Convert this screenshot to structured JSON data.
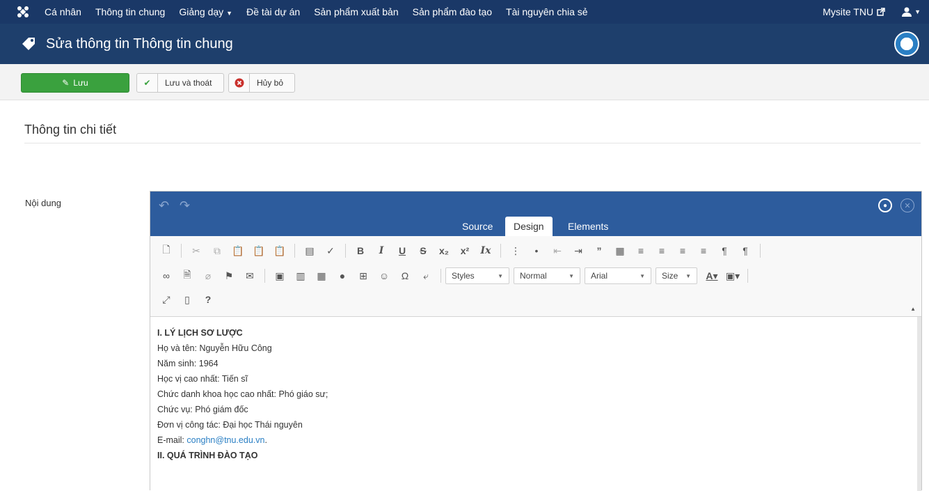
{
  "nav": {
    "items": [
      {
        "label": "Cá nhân"
      },
      {
        "label": "Thông tin chung"
      },
      {
        "label": "Giảng dạy",
        "dropdown": true
      },
      {
        "label": "Đề tài dự án"
      },
      {
        "label": "Sản phẩm xuất bản"
      },
      {
        "label": "Sản phẩm đào tạo"
      },
      {
        "label": "Tài nguyên chia sẻ"
      }
    ],
    "mysite": "Mysite TNU",
    "logo_icon": "joomla-logo-icon",
    "user_icon": "user-icon"
  },
  "header": {
    "title": "Sửa thông tin Thông tin chung",
    "icon": "tag-icon"
  },
  "toolbar": {
    "save_label": "Lưu",
    "save_close_label": "Lưu và thoát",
    "cancel_label": "Hủy bỏ"
  },
  "section": {
    "title": "Thông tin chi tiết"
  },
  "field": {
    "label": "Nội dung"
  },
  "editor": {
    "tabs": [
      "Source",
      "Design",
      "Elements"
    ],
    "active_tab": "Design",
    "combos": {
      "styles": "Styles",
      "format": "Normal",
      "font": "Arial",
      "size": "Size"
    },
    "content": [
      {
        "text": "I. LÝ LỊCH SƠ LƯỢC",
        "bold": true
      },
      {
        "text": "Họ và tên: Nguyễn Hữu Công"
      },
      {
        "text": "Năm sinh: 1964"
      },
      {
        "text": "Học vị cao nhất: Tiến sĩ"
      },
      {
        "text": "Chức danh khoa học cao nhất: Phó giáo sư;"
      },
      {
        "text": "Chức vụ: Phó giám đốc"
      },
      {
        "text": "Đơn vị công tác:  Đại học Thái nguyên"
      },
      {
        "text": "E-mail: ",
        "link": "conghn@tnu.edu.vn",
        "after": "."
      },
      {
        "text": "II. QUÁ TRÌNH ĐÀO TẠO",
        "bold": true
      }
    ]
  },
  "colors": {
    "nav_bg": "#1a3867",
    "title_bg": "#1e3f6c",
    "editor_head": "#2d5c9d",
    "save_green": "#3aa13e",
    "link": "#2a7fc4"
  }
}
